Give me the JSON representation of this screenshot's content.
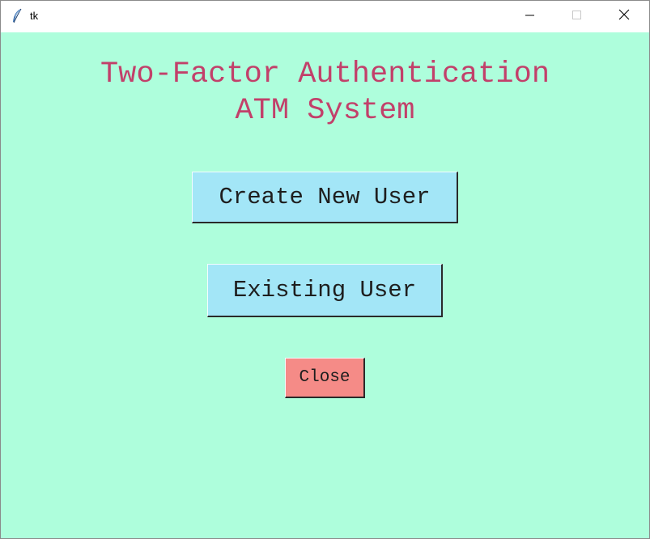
{
  "window": {
    "title": "tk",
    "icon": "feather-icon",
    "controls": {
      "minimize_icon": "minimize-icon",
      "maximize_icon": "maximize-icon",
      "close_icon": "close-icon"
    }
  },
  "main": {
    "heading_line1": "Two-Factor Authentication",
    "heading_line2": "ATM System",
    "create_user_label": "Create New User",
    "existing_user_label": "Existing User",
    "close_label": "Close"
  },
  "colors": {
    "background": "#aefedc",
    "heading": "#c2406a",
    "primary_button": "#a3e6f7",
    "close_button": "#f58b87"
  }
}
